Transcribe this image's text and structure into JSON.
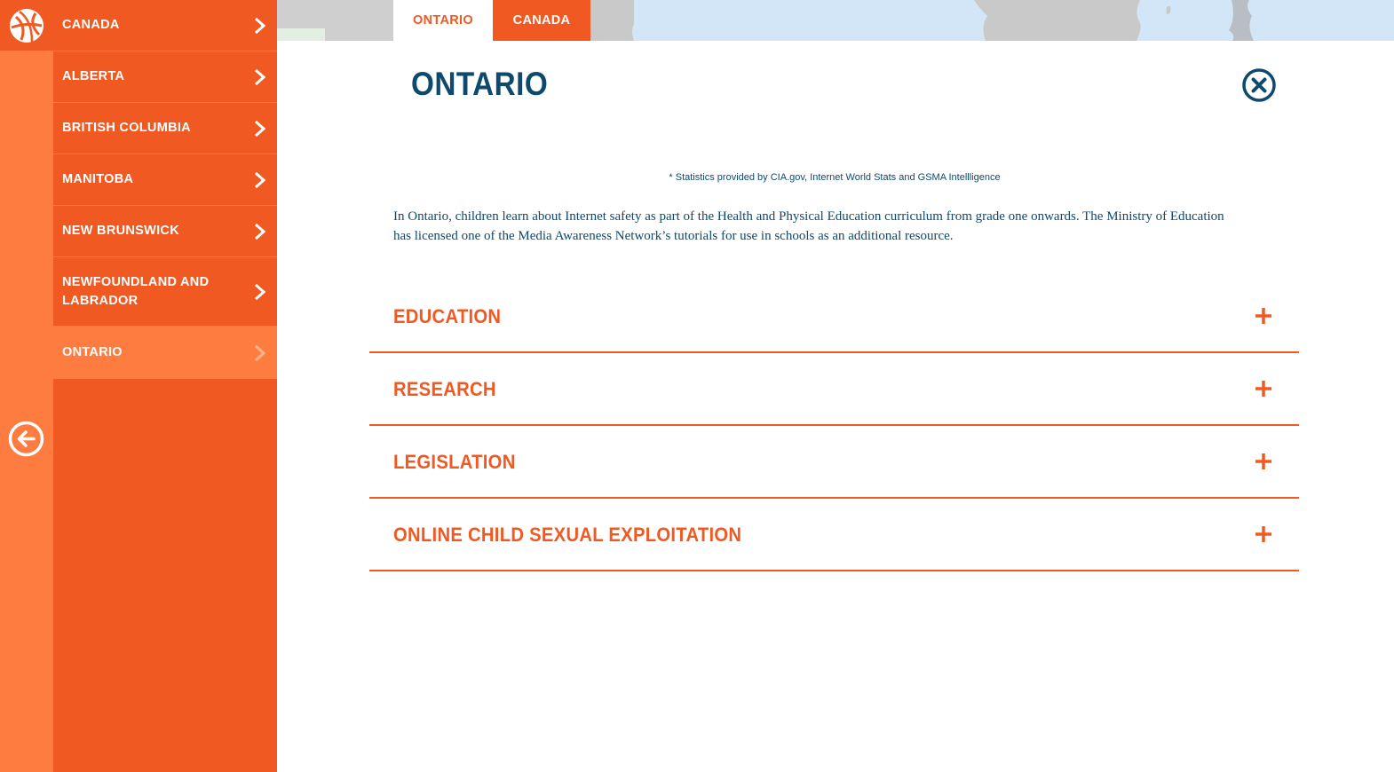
{
  "sidebar": {
    "items": [
      {
        "label": "CANADA",
        "active": false
      },
      {
        "label": "ALBERTA",
        "active": false
      },
      {
        "label": "BRITISH COLUMBIA",
        "active": false
      },
      {
        "label": "MANITOBA",
        "active": false
      },
      {
        "label": "NEW BRUNSWICK",
        "active": false
      },
      {
        "label": "NEWFOUNDLAND AND LABRADOR",
        "active": false
      },
      {
        "label": "ONTARIO",
        "active": true
      }
    ],
    "back_icon": "arrow-left-circle-icon"
  },
  "tabs": [
    {
      "label": "ONTARIO",
      "active": true
    },
    {
      "label": "CANADA",
      "active": false
    }
  ],
  "main": {
    "title": "ONTARIO",
    "stats_note": "* Statistics provided by CIA.gov, Internet World Stats and GSMA Intellligence",
    "intro": "In Ontario, children learn about Internet safety as part of the Health and Physical Education curriculum from grade one onwards. The Ministry of Education has licensed one of the Media Awareness Network’s tutorials for use in schools as an additional resource.",
    "sections": [
      {
        "label": "EDUCATION"
      },
      {
        "label": "RESEARCH"
      },
      {
        "label": "LEGISLATION"
      },
      {
        "label": "ONLINE CHILD SEXUAL EXPLOITATION"
      }
    ]
  },
  "colors": {
    "brand_orange": "#f05a22",
    "light_orange": "#ff7c40",
    "navy": "#0d4a6e",
    "map_water": "#d2e6f7",
    "map_land": "#c9c9c9"
  }
}
